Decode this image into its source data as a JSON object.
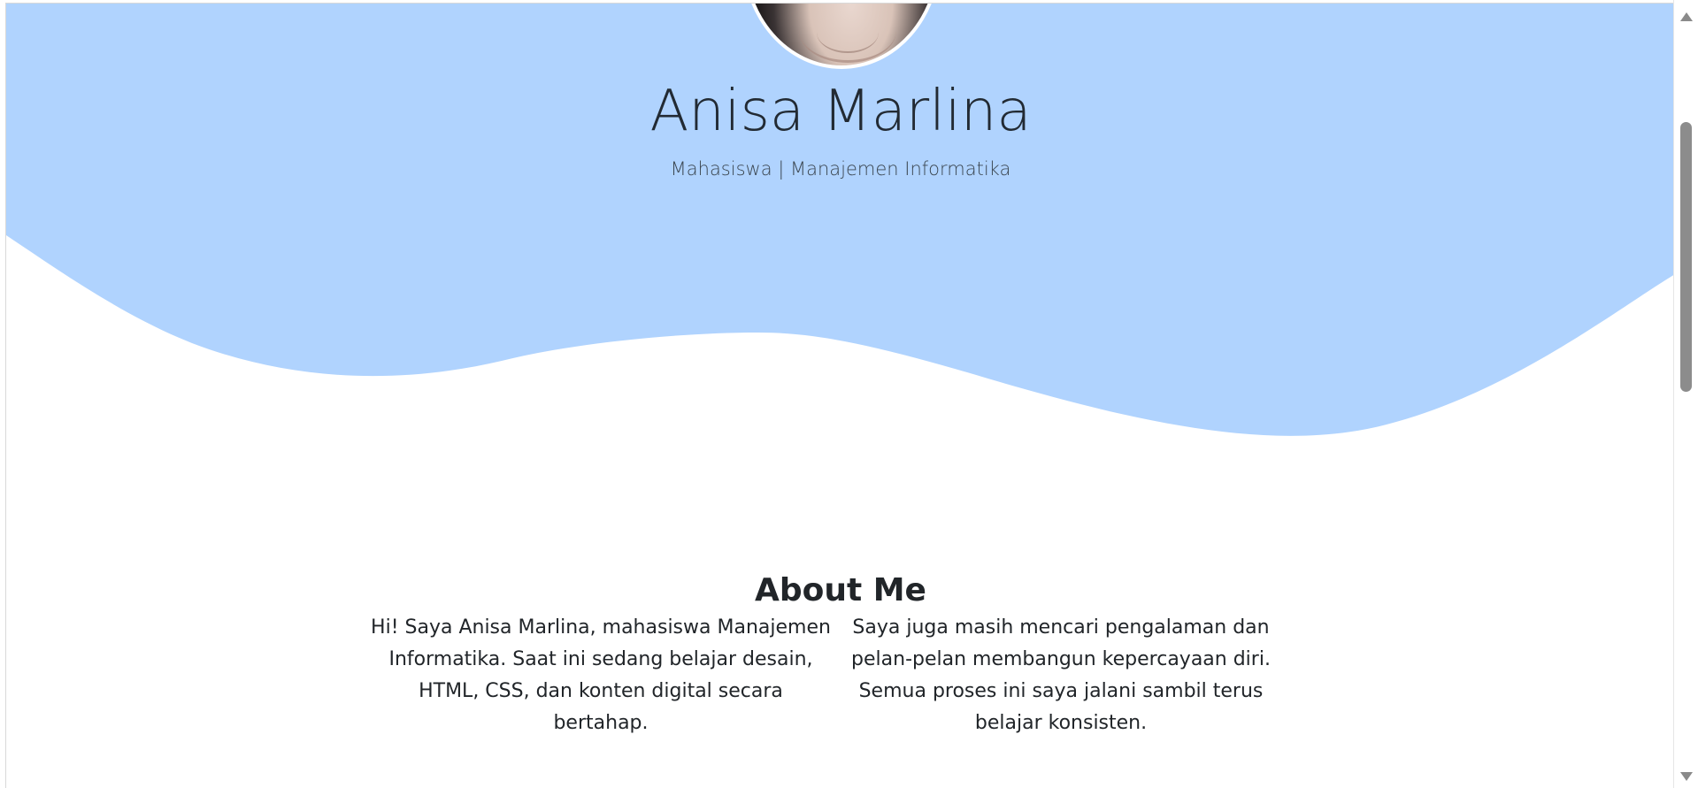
{
  "profile": {
    "name": "Anisa Marlina",
    "subtitle": "Mahasiswa | Manajemen Informatika"
  },
  "about": {
    "title": "About Me",
    "paragraphs": [
      "Hi! Saya Anisa Marlina, mahasiswa Manajemen Informatika. Saat ini sedang belajar desain, HTML, CSS, dan konten digital secara bertahap.",
      "Saya juga masih mencari pengalaman dan pelan-pelan membangun kepercayaan diri. Semua proses ini saya jalani sambil terus belajar konsisten."
    ]
  },
  "colors": {
    "hero_background": "#b0d3fe",
    "page_background": "#ffffff",
    "text_primary": "#212529",
    "scrollbar_thumb": "#8c8c8c"
  },
  "scrollbar": {
    "scroll_position_fraction": 0.17
  }
}
